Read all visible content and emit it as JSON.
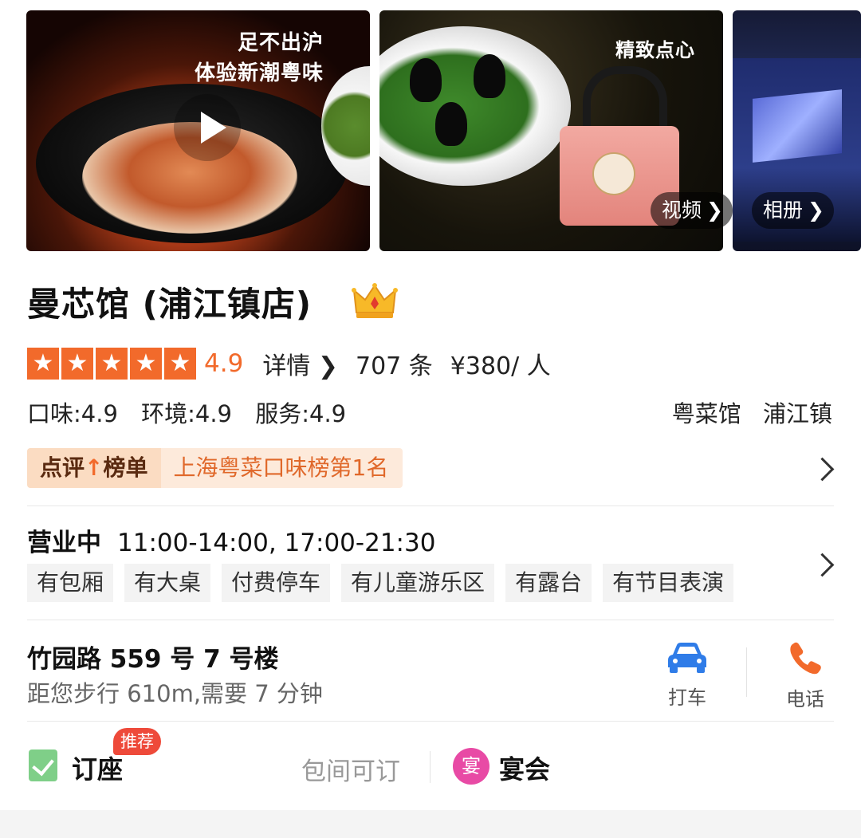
{
  "gallery": {
    "photo1_caption_line1": "足不出沪",
    "photo1_caption_line2": "体验新潮粤味",
    "photo2_caption": "精致点心",
    "video_label": "视频",
    "album_label": "相册",
    "chevron": "❯"
  },
  "shop": {
    "name": "曼芯馆 (浦江镇店)",
    "star_glyph": "★",
    "rating_stars": 5,
    "score": "4.9",
    "detail_label": "详情 ❯",
    "review_count": "707 条",
    "price": "¥380/ 人",
    "taste": "口味:4.9",
    "environment": "环境:4.9",
    "service": "服务:4.9",
    "category": "粤菜馆",
    "area": "浦江镇"
  },
  "ranking": {
    "badge_part1": "点评",
    "badge_arrow": "↑",
    "badge_part2": "榜单",
    "text": "上海粤菜口味榜第1名"
  },
  "hours": {
    "status": "营业中",
    "times": "11:00-14:00, 17:00-21:30"
  },
  "tags": [
    "有包厢",
    "有大桌",
    "付费停车",
    "有儿童游乐区",
    "有露台",
    "有节目表演"
  ],
  "address": {
    "street": "竹园路 559 号 7 号楼",
    "distance": "距您步行 610m,需要 7 分钟"
  },
  "actions": {
    "taxi": "打车",
    "phone": "电话"
  },
  "bottom": {
    "book": "订座",
    "recommend_badge": "推荐",
    "room": "包间可订",
    "banquet_icon": "宴",
    "banquet": "宴会"
  },
  "colors": {
    "accent_orange": "#f26a2b",
    "taxi_blue": "#2f7ce8",
    "banquet_pink": "#e84aa5",
    "check_green": "#7fcf88",
    "recommend_red": "#ee4a3a"
  }
}
